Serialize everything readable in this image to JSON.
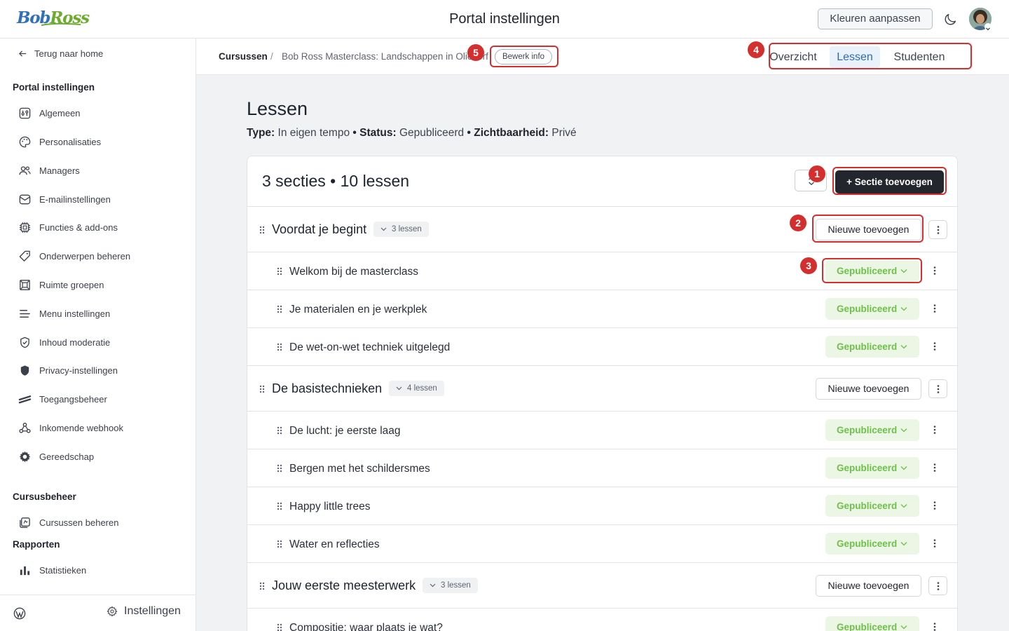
{
  "header": {
    "logo_word1": "Bob",
    "logo_word2": "Ross",
    "title": "Portal instellingen",
    "color_button": "Kleuren aanpassen",
    "theme_icon": "moon-icon",
    "avatar_icon": "user-avatar"
  },
  "sidebar": {
    "back_link": "Terug naar home",
    "groups": [
      {
        "heading": "Portal instellingen",
        "items": [
          {
            "label": "Algemeen",
            "icon": "sliders-icon"
          },
          {
            "label": "Personalisaties",
            "icon": "palette-icon"
          },
          {
            "label": "Managers",
            "icon": "users-icon"
          },
          {
            "label": "E-mailinstellingen",
            "icon": "mail-icon"
          },
          {
            "label": "Functies & add-ons",
            "icon": "chip-icon"
          },
          {
            "label": "Onderwerpen beheren",
            "icon": "tag-icon"
          },
          {
            "label": "Ruimte groepen",
            "icon": "group-icon"
          },
          {
            "label": "Menu instellingen",
            "icon": "menu-icon"
          },
          {
            "label": "Inhoud moderatie",
            "icon": "shield-check-icon"
          },
          {
            "label": "Privacy-instellingen",
            "icon": "shield-icon"
          },
          {
            "label": "Toegangsbeheer",
            "icon": "access-icon"
          },
          {
            "label": "Inkomende webhook",
            "icon": "webhook-icon"
          },
          {
            "label": "Gereedschap",
            "icon": "gear-icon"
          }
        ]
      },
      {
        "heading": "Cursusbeheer",
        "items": [
          {
            "label": "Cursussen beheren",
            "icon": "courses-icon"
          }
        ]
      },
      {
        "heading": "Rapporten",
        "items": [
          {
            "label": "Statistieken",
            "icon": "bar-chart-icon"
          }
        ]
      }
    ],
    "footer": {
      "wordpress_icon": "wordpress-icon",
      "settings_label": "Instellingen"
    }
  },
  "subheader": {
    "breadcrumb_root": "Cursussen",
    "breadcrumb_separator": "/",
    "breadcrumb_course": "Bob Ross Masterclass: Landschappen in Olieverf",
    "edit_info": "Bewerk info",
    "tabs": [
      {
        "label": "Overzicht",
        "active": false
      },
      {
        "label": "Lessen",
        "active": true
      },
      {
        "label": "Studenten",
        "active": false
      }
    ]
  },
  "main": {
    "title": "Lessen",
    "meta": {
      "type_label": "Type:",
      "type_value": "In eigen tempo",
      "status_label": "Status:",
      "status_value": "Gepubliceerd",
      "visibility_label": "Zichtbaarheid:",
      "visibility_value": "Privé",
      "separator": "•"
    },
    "counts": "3 secties • 10 lessen",
    "add_section_button": "+ Sectie toevoegen",
    "sections": [
      {
        "title": "Voordat je begint",
        "lesson_count": "3 lessen",
        "new_button": "Nieuwe toevoegen",
        "lessons": [
          {
            "title": "Welkom bij de masterclass",
            "status": "Gepubliceerd"
          },
          {
            "title": "Je materialen en je werkplek",
            "status": "Gepubliceerd"
          },
          {
            "title": "De wet-on-wet techniek uitgelegd",
            "status": "Gepubliceerd"
          }
        ]
      },
      {
        "title": "De basistechnieken",
        "lesson_count": "4 lessen",
        "new_button": "Nieuwe toevoegen",
        "lessons": [
          {
            "title": "De lucht: je eerste laag",
            "status": "Gepubliceerd"
          },
          {
            "title": "Bergen met het schildersmes",
            "status": "Gepubliceerd"
          },
          {
            "title": "Happy little trees",
            "status": "Gepubliceerd"
          },
          {
            "title": "Water en reflecties",
            "status": "Gepubliceerd"
          }
        ]
      },
      {
        "title": "Jouw eerste meesterwerk",
        "lesson_count": "3 lessen",
        "new_button": "Nieuwe toevoegen",
        "lessons": [
          {
            "title": "Compositie: waar plaats je wat?",
            "status": "Gepubliceerd"
          }
        ]
      }
    ]
  },
  "annotations": {
    "color": "#d32f2f",
    "labels": [
      "1",
      "2",
      "3",
      "4",
      "5"
    ]
  },
  "colors": {
    "accent": "#2e6ab5",
    "published_text": "#6ec04a",
    "published_bg": "#ebf7e4",
    "primary_button": "#24262d",
    "logo_blue": "#2f70b8",
    "logo_green": "#6cab2e"
  }
}
